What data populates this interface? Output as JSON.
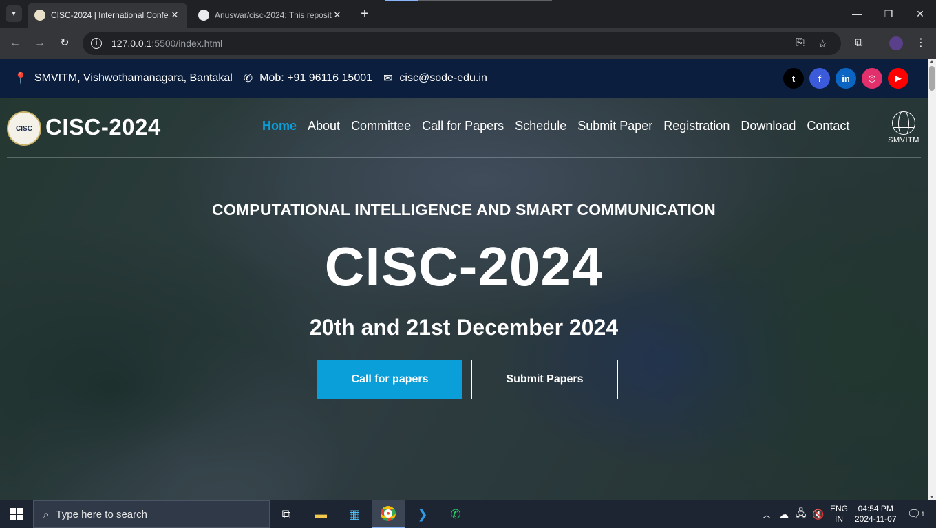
{
  "browser": {
    "tabs": [
      {
        "title": "CISC-2024 | International Confe",
        "active": true
      },
      {
        "title": "Anuswar/cisc-2024: This reposit",
        "active": false
      }
    ],
    "url_host": "127.0.0.1",
    "url_rest": ":5500/index.html"
  },
  "topbar": {
    "address": "SMVITM, Vishwothamanagara, Bantakal",
    "phone": "Mob: +91 96116 15001",
    "email": "cisc@sode-edu.in",
    "socials": [
      {
        "name": "twitter",
        "glyph": "t",
        "color": "#000000"
      },
      {
        "name": "facebook",
        "glyph": "f",
        "color": "#3b5bdb"
      },
      {
        "name": "linkedin",
        "glyph": "in",
        "color": "#0a66c2"
      },
      {
        "name": "instagram",
        "glyph": "◎",
        "color": "#e1306c"
      },
      {
        "name": "youtube",
        "glyph": "▶",
        "color": "#ff0000"
      }
    ]
  },
  "navbar": {
    "logo_text": "CISC",
    "brand": "CISC-2024",
    "menu": [
      "Home",
      "About",
      "Committee",
      "Call for Papers",
      "Schedule",
      "Submit Paper",
      "Registration",
      "Download",
      "Contact"
    ],
    "active_index": 0,
    "partner_label": "SMVITM"
  },
  "hero": {
    "tagline": "COMPUTATIONAL INTELLIGENCE AND SMART COMMUNICATION",
    "title": "CISC-2024",
    "date": "20th and 21st December 2024",
    "primary_button": "Call for papers",
    "secondary_button": "Submit Papers"
  },
  "taskbar": {
    "search_placeholder": "Type here to search",
    "lang_top": "ENG",
    "lang_bottom": "IN",
    "time": "04:54 PM",
    "date": "2024-11-07",
    "notification_count": "1"
  },
  "colors": {
    "accent": "#0a9fd8",
    "topbar_bg": "#0b1e3d"
  }
}
